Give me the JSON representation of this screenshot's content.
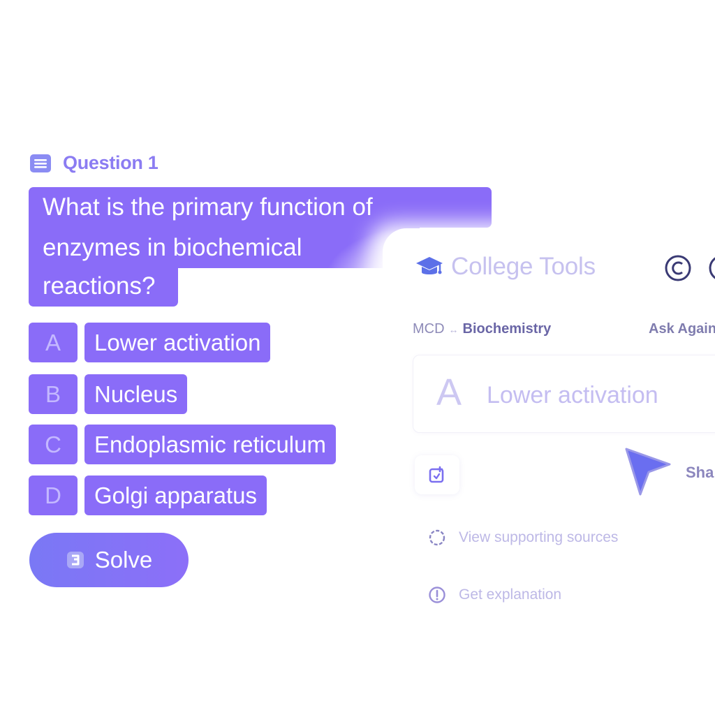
{
  "question": {
    "header": "Question 1",
    "header_icon": "document-list-icon",
    "lines": [
      "What is the primary function of",
      "enzymes in biochemical",
      "reactions?"
    ]
  },
  "options": [
    {
      "letter": "A",
      "text": "Lower activation"
    },
    {
      "letter": "B",
      "text": "Nucleus"
    },
    {
      "letter": "C",
      "text": "Endoplasmic reticulum"
    },
    {
      "letter": "D",
      "text": "Golgi apparatus"
    }
  ],
  "solve": {
    "label": "Solve",
    "icon": "solve-icon"
  },
  "panel": {
    "brand": "College Tools",
    "brand_icon": "graduation-cap-icon",
    "breadcrumb": {
      "course": "MCD",
      "separator": "↔",
      "subject": "Biochemistry"
    },
    "ask_again": "Ask Again",
    "answer": {
      "letter": "A",
      "text": "Lower activation"
    },
    "share_label": "Sha",
    "links": [
      {
        "label": "View supporting sources",
        "icon": "sources-circle-icon"
      },
      {
        "label": "Get explanation",
        "icon": "info-icon"
      }
    ]
  },
  "colors": {
    "accent": "#8a6cf8",
    "accent_light": "#8b7cf2",
    "muted_text": "#bdb8e6",
    "cursor": "#6a6ef0"
  }
}
